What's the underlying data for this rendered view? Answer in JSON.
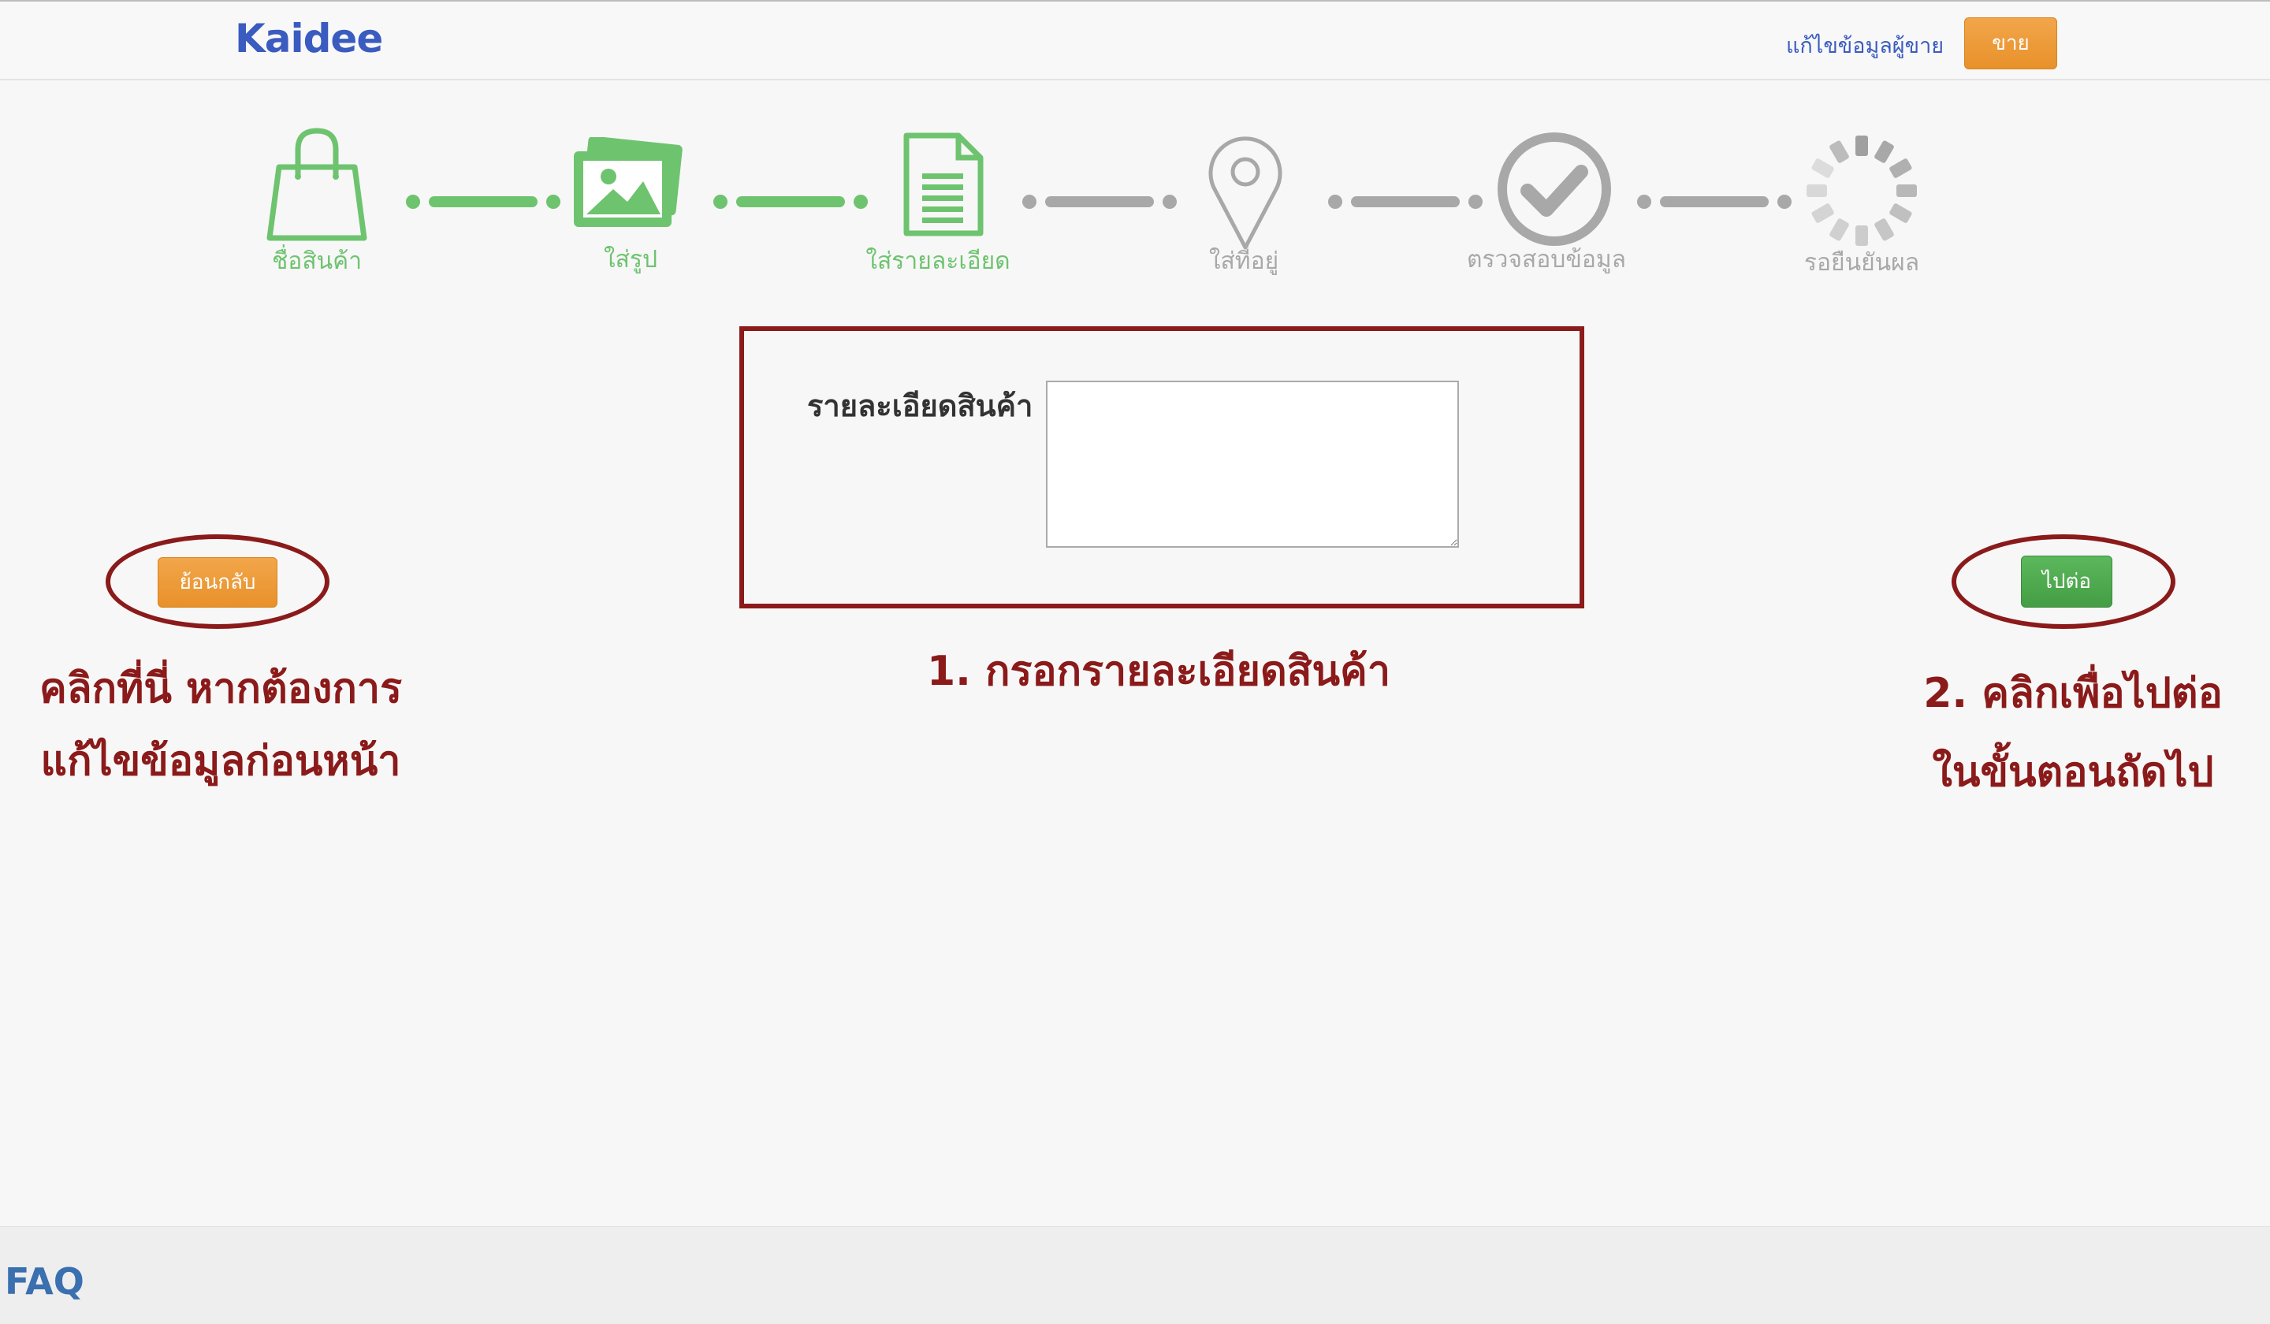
{
  "header": {
    "logo": "Kaidee",
    "seller_link": "แก้ไขข้อมูลผู้ขาย",
    "sell_button": "ขาย"
  },
  "steps": [
    {
      "label": "ชื่อสินค้า",
      "state": "done",
      "icon": "shopping-bag-icon"
    },
    {
      "label": "ใส่รูป",
      "state": "done",
      "icon": "photos-icon"
    },
    {
      "label": "ใส่รายละเอียด",
      "state": "current",
      "icon": "document-icon"
    },
    {
      "label": "ใส่ที่อยู่",
      "state": "pending",
      "icon": "map-pin-icon"
    },
    {
      "label": "ตรวจสอบข้อมูล",
      "state": "pending",
      "icon": "check-circle-icon"
    },
    {
      "label": "รอยืนยันผล",
      "state": "pending",
      "icon": "loading-spinner-icon"
    }
  ],
  "form": {
    "description_label": "รายละเอียดสินค้า",
    "description_value": ""
  },
  "buttons": {
    "back": "ย้อนกลับ",
    "next": "ไปต่อ"
  },
  "annotations": {
    "left_line1": "คลิกที่นี่ หากต้องการ",
    "left_line2": "แก้ไขข้อมูลก่อนหน้า",
    "center": "1. กรอกรายละเอียดสินค้า",
    "right_line1": "2. คลิกเพื่อไปต่อ",
    "right_line2": "ในขั้นตอนถัดไป"
  },
  "footer": {
    "faq": "FAQ"
  },
  "colors": {
    "done": "#6ec36f",
    "pending": "#a8a8a8",
    "annotation": "#8b1a1a",
    "brand": "#3a5bbf"
  }
}
